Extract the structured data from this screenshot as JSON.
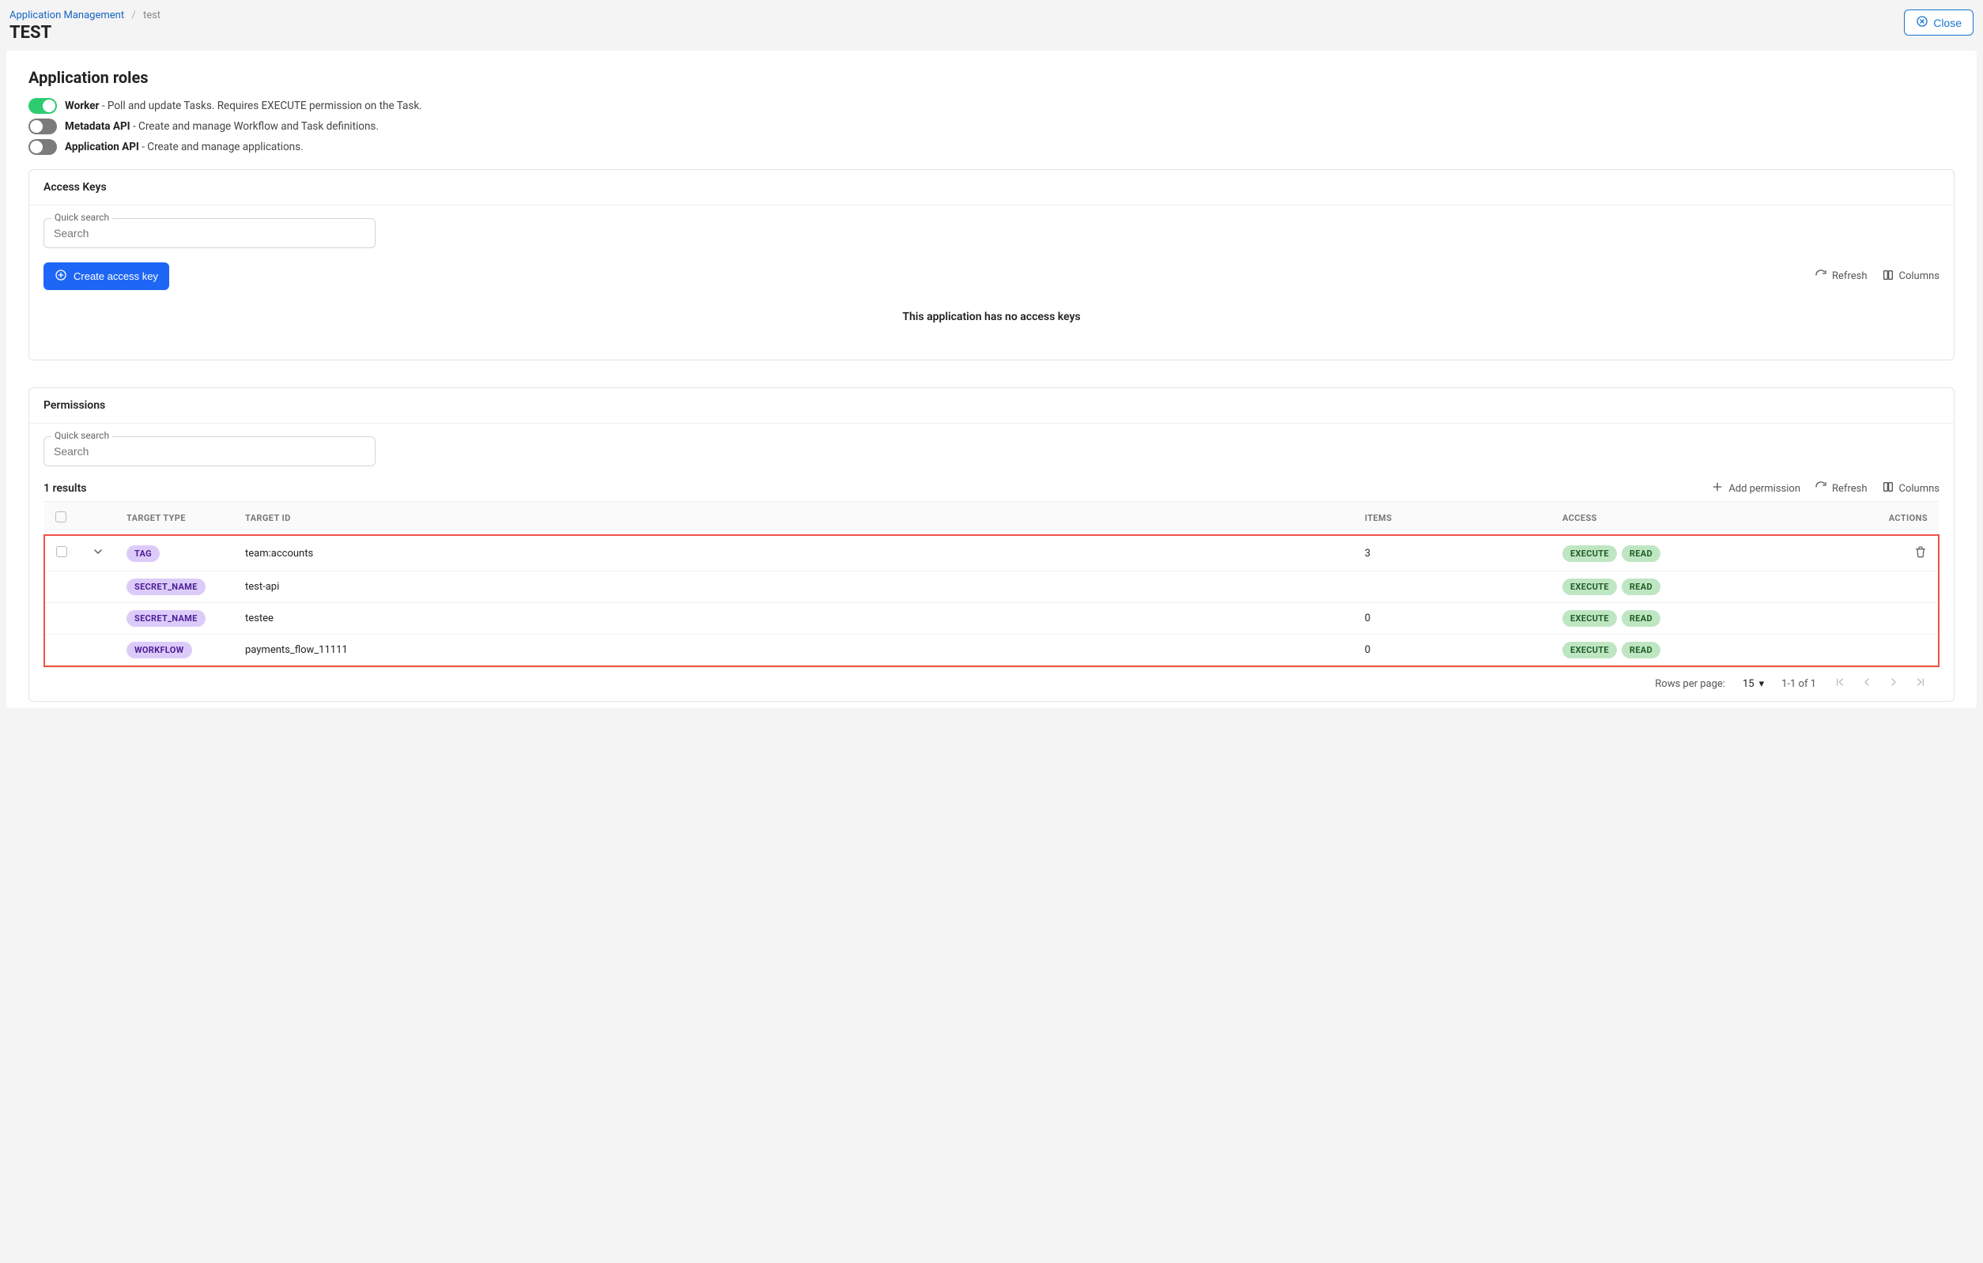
{
  "breadcrumb": {
    "root": "Application Management",
    "current": "test"
  },
  "page_title": "TEST",
  "close_label": "Close",
  "roles": {
    "heading": "Application roles",
    "items": [
      {
        "name": "Worker",
        "desc": " - Poll and update Tasks. Requires EXECUTE permission on the Task.",
        "on": true
      },
      {
        "name": "Metadata API",
        "desc": " - Create and manage Workflow and Task definitions.",
        "on": false
      },
      {
        "name": "Application API",
        "desc": " - Create and manage applications.",
        "on": false
      }
    ]
  },
  "access_keys": {
    "heading": "Access Keys",
    "search_label": "Quick search",
    "search_placeholder": "Search",
    "create_label": "Create access key",
    "refresh_label": "Refresh",
    "columns_label": "Columns",
    "empty": "This application has no access keys"
  },
  "permissions": {
    "heading": "Permissions",
    "search_label": "Quick search",
    "search_placeholder": "Search",
    "results_text": "1 results",
    "add_label": "Add permission",
    "refresh_label": "Refresh",
    "columns_label": "Columns",
    "table": {
      "headers": {
        "target_type": "TARGET TYPE",
        "target_id": "TARGET ID",
        "items": "ITEMS",
        "access": "ACCESS",
        "actions": "ACTIONS"
      },
      "rows": [
        {
          "type": "TAG",
          "id": "team:accounts",
          "items": "3",
          "access": [
            "EXECUTE",
            "READ"
          ],
          "expandable": true,
          "deletable": true
        },
        {
          "type": "SECRET_NAME",
          "id": "test-api",
          "items": "",
          "access": [
            "EXECUTE",
            "READ"
          ],
          "expandable": false,
          "deletable": false
        },
        {
          "type": "SECRET_NAME",
          "id": "testee",
          "items": "0",
          "access": [
            "EXECUTE",
            "READ"
          ],
          "expandable": false,
          "deletable": false
        },
        {
          "type": "WORKFLOW",
          "id": "payments_flow_11111",
          "items": "0",
          "access": [
            "EXECUTE",
            "READ"
          ],
          "expandable": false,
          "deletable": false
        }
      ]
    },
    "pagination": {
      "rows_label": "Rows per page:",
      "rows_value": "15",
      "range": "1-1 of 1"
    }
  }
}
